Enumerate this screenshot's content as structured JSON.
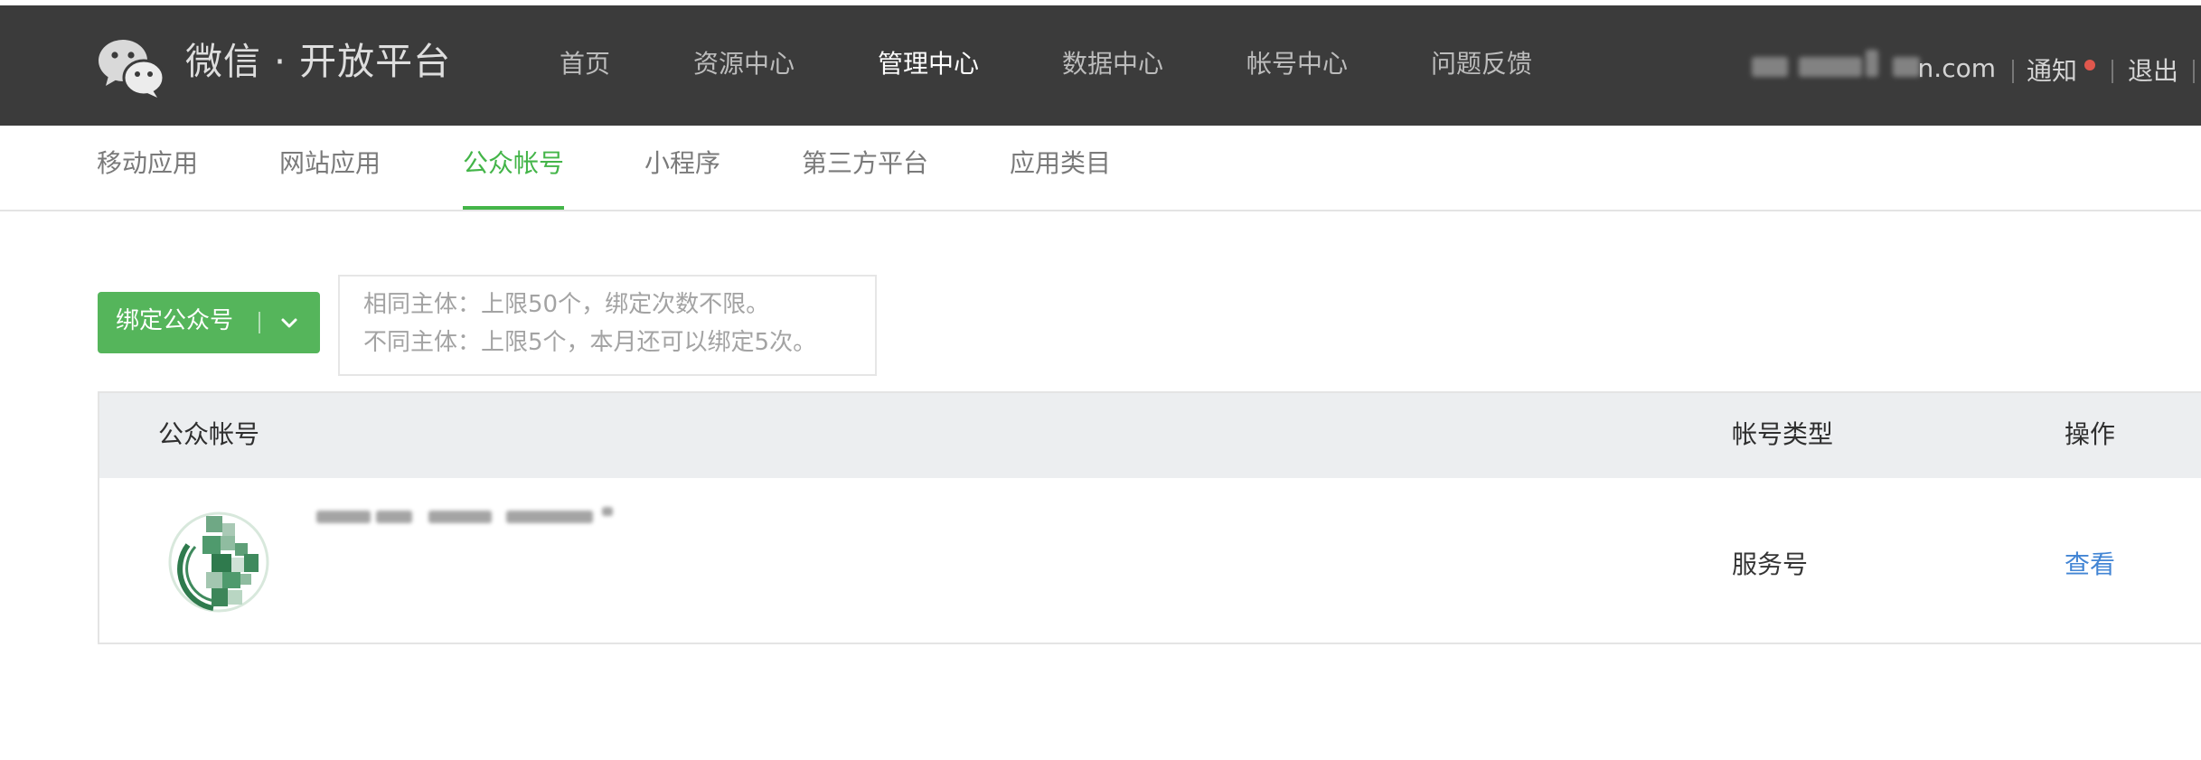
{
  "brand": {
    "name": "微信 · 开放平台",
    "logo_icon": "wechat-logo-icon"
  },
  "top_nav": [
    {
      "label": "首页",
      "active": false
    },
    {
      "label": "资源中心",
      "active": false
    },
    {
      "label": "管理中心",
      "active": true
    },
    {
      "label": "数据中心",
      "active": false
    },
    {
      "label": "帐号中心",
      "active": false
    },
    {
      "label": "问题反馈",
      "active": false
    }
  ],
  "user": {
    "email_suffix": "n.com",
    "notify_label": "通知",
    "logout_label": "退出"
  },
  "sub_nav": [
    {
      "label": "移动应用",
      "active": false
    },
    {
      "label": "网站应用",
      "active": false
    },
    {
      "label": "公众帐号",
      "active": true
    },
    {
      "label": "小程序",
      "active": false
    },
    {
      "label": "第三方平台",
      "active": false
    },
    {
      "label": "应用类目",
      "active": false
    }
  ],
  "bind_button": {
    "label": "绑定公众号",
    "icon": "chevron-down-icon"
  },
  "tips": [
    "相同主体：上限50个，绑定次数不限。",
    "不同主体：上限5个，本月还可以绑定5次。"
  ],
  "table": {
    "headers": {
      "account": "公众帐号",
      "type": "帐号类型",
      "action": "操作"
    },
    "rows": [
      {
        "type": "服务号",
        "action": "查看"
      }
    ]
  },
  "colors": {
    "topbar_bg": "#3b3b3b",
    "accent_green": "#44b549",
    "button_green": "#55b55b",
    "link_blue": "#4285d4",
    "notify_dot": "#e0574d"
  }
}
